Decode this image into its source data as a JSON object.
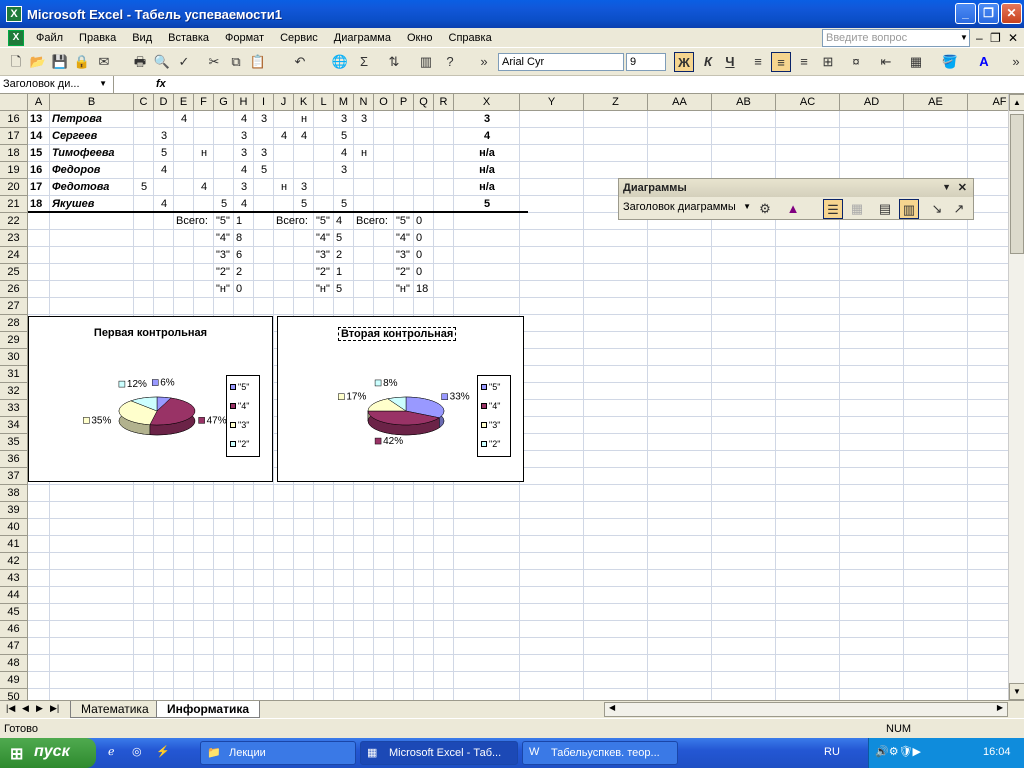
{
  "window": {
    "title": "Microsoft Excel - Табель успеваемости1",
    "app_icon": "excel-icon",
    "minimize": "_",
    "maximize": "❐",
    "close": "✕"
  },
  "menu": {
    "items": [
      "Файл",
      "Правка",
      "Вид",
      "Вставка",
      "Формат",
      "Сервис",
      "Диаграмма",
      "Окно",
      "Справка"
    ],
    "help_placeholder": "Введите вопрос",
    "mdi": [
      "–",
      "❐",
      "✕"
    ]
  },
  "toolbar": {
    "font": "Arial Cyr",
    "size": "9",
    "bold": "Ж",
    "italic": "К",
    "underline": "Ч"
  },
  "formula_bar": {
    "name_box": "Заголовок ди...",
    "fx": "fx"
  },
  "columns": [
    "A",
    "B",
    "C",
    "D",
    "E",
    "F",
    "G",
    "H",
    "I",
    "J",
    "K",
    "L",
    "M",
    "N",
    "O",
    "P",
    "Q",
    "R",
    "X",
    "Y",
    "Z",
    "AA",
    "AB",
    "AC",
    "AD",
    "AE",
    "AF"
  ],
  "rows": [
    "16",
    "17",
    "18",
    "19",
    "20",
    "21",
    "22",
    "23",
    "24",
    "25",
    "26",
    "27",
    "28",
    "29",
    "30",
    "31",
    "32",
    "33",
    "34",
    "35",
    "36",
    "37",
    "38",
    "39",
    "40",
    "41",
    "42",
    "43",
    "44",
    "45",
    "46",
    "47",
    "48",
    "49",
    "50"
  ],
  "students": [
    {
      "num": "13",
      "name": "Петрова",
      "grades": {
        "E": "4",
        "H": "4",
        "I": "3",
        "K": "н",
        "M": "3",
        "N": "3"
      },
      "final": "3"
    },
    {
      "num": "14",
      "name": "Сергеев",
      "grades": {
        "D": "3",
        "H": "3",
        "J": "4",
        "K": "4",
        "M": "5"
      },
      "final": "4"
    },
    {
      "num": "15",
      "name": "Тимофеева",
      "grades": {
        "D": "5",
        "F": "н",
        "H": "3",
        "I": "3",
        "M": "4",
        "N": "н"
      },
      "final": "н/а"
    },
    {
      "num": "16",
      "name": "Федоров",
      "grades": {
        "D": "4",
        "H": "4",
        "I": "5",
        "M": "3"
      },
      "final": "н/а"
    },
    {
      "num": "17",
      "name": "Федотова",
      "grades": {
        "C": "5",
        "F": "4",
        "H": "3",
        "J": "н",
        "K": "3"
      },
      "final": "н/а"
    },
    {
      "num": "18",
      "name": "Якушев",
      "grades": {
        "D": "4",
        "G": "5",
        "H": "4",
        "K": "5",
        "M": "5"
      },
      "final": "5"
    }
  ],
  "totals": {
    "label": "Всего:",
    "grade_labels": [
      "\"5\"",
      "\"4\"",
      "\"3\"",
      "\"2\"",
      "\"н\""
    ],
    "block1": [
      "1",
      "8",
      "6",
      "2",
      "0"
    ],
    "block2": [
      "4",
      "5",
      "2",
      "1",
      "5"
    ],
    "block3": [
      "0",
      "0",
      "0",
      "0",
      "18"
    ]
  },
  "chart_data": [
    {
      "type": "pie",
      "title": "Первая контрольная",
      "categories": [
        "\"5\"",
        "\"4\"",
        "\"3\"",
        "\"2\""
      ],
      "values": [
        6,
        47,
        35,
        12
      ],
      "data_labels": [
        "6%",
        "47%",
        "35%",
        "12%"
      ],
      "colors": [
        "#9999ff",
        "#993366",
        "#ffffcc",
        "#ccffff"
      ]
    },
    {
      "type": "pie",
      "title": "Вторая контрольная",
      "categories": [
        "\"5\"",
        "\"4\"",
        "\"3\"",
        "\"2\""
      ],
      "values": [
        33,
        42,
        17,
        8
      ],
      "data_labels": [
        "33%",
        "42%",
        "17%",
        "8%"
      ],
      "colors": [
        "#9999ff",
        "#993366",
        "#ffffcc",
        "#ccffff"
      ]
    }
  ],
  "chart_toolbar": {
    "title": "Диаграммы",
    "dropdown": "Заголовок диаграммы"
  },
  "sheets": {
    "nav": [
      "|◀",
      "◀",
      "▶",
      "▶|"
    ],
    "tabs": [
      "Математика",
      "Информатика"
    ],
    "active": "Информатика"
  },
  "status": {
    "left": "Готово",
    "num": "NUM"
  },
  "taskbar": {
    "start": "пуск",
    "buttons": [
      "Лекции",
      "Microsoft Excel - Таб...",
      "Табельуспкев. теор..."
    ],
    "lang": "RU",
    "clock": "16:04"
  }
}
